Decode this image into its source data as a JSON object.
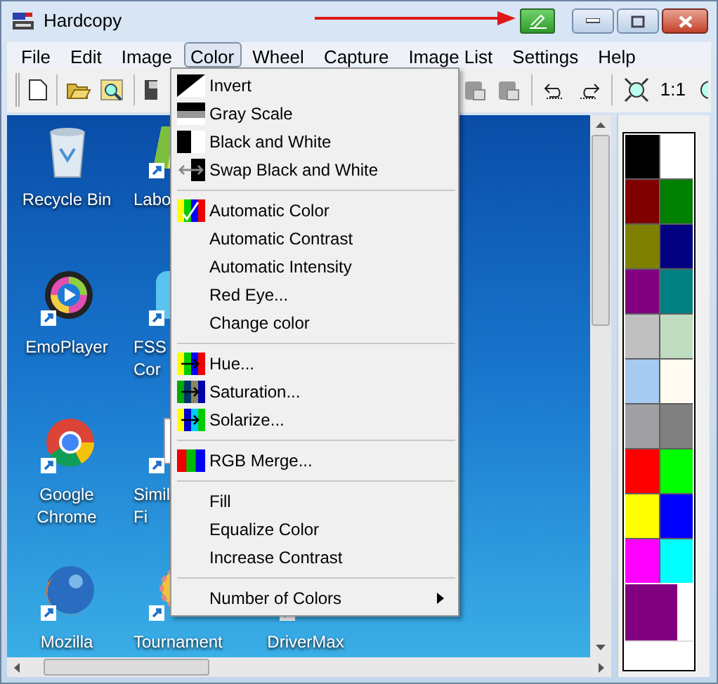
{
  "window": {
    "title": "Hardcopy"
  },
  "menubar": [
    {
      "label": "File",
      "selected": false
    },
    {
      "label": "Edit",
      "selected": false
    },
    {
      "label": "Image",
      "selected": false
    },
    {
      "label": "Color",
      "selected": true
    },
    {
      "label": "Wheel",
      "selected": false
    },
    {
      "label": "Capture",
      "selected": false
    },
    {
      "label": "Image List",
      "selected": false
    },
    {
      "label": "Settings",
      "selected": false
    },
    {
      "label": "Help",
      "selected": false
    }
  ],
  "toolbar": {
    "zoom_label": "1:1"
  },
  "desktop": {
    "rows": [
      [
        {
          "lines": [
            "Recycle Bin"
          ]
        },
        {
          "lines": [
            "Labo"
          ]
        }
      ],
      [
        {
          "lines": [
            "EmoPlayer"
          ]
        },
        {
          "lines": [
            "FSS",
            "Cor"
          ]
        }
      ],
      [
        {
          "lines": [
            "Google",
            "Chrome"
          ]
        },
        {
          "lines": [
            "Simil",
            "Fi"
          ]
        }
      ],
      [
        {
          "lines": [
            "Mozilla"
          ]
        },
        {
          "lines": [
            "Tournament"
          ]
        },
        {
          "lines": [
            "DriverMax"
          ]
        }
      ]
    ]
  },
  "color_menu": {
    "items": [
      {
        "kind": "item",
        "label": "Invert"
      },
      {
        "kind": "item",
        "label": "Gray Scale"
      },
      {
        "kind": "item",
        "label": "Black and White"
      },
      {
        "kind": "item",
        "label": "Swap Black and White"
      },
      {
        "kind": "separator"
      },
      {
        "kind": "item",
        "label": "Automatic Color"
      },
      {
        "kind": "item",
        "label": "Automatic Contrast"
      },
      {
        "kind": "item",
        "label": "Automatic Intensity"
      },
      {
        "kind": "item",
        "label": "Red Eye..."
      },
      {
        "kind": "item",
        "label": "Change color"
      },
      {
        "kind": "separator"
      },
      {
        "kind": "item",
        "label": "Hue..."
      },
      {
        "kind": "item",
        "label": "Saturation..."
      },
      {
        "kind": "item",
        "label": "Solarize..."
      },
      {
        "kind": "separator"
      },
      {
        "kind": "item",
        "label": "RGB Merge..."
      },
      {
        "kind": "separator"
      },
      {
        "kind": "item",
        "label": "Fill"
      },
      {
        "kind": "item",
        "label": "Equalize Color"
      },
      {
        "kind": "item",
        "label": "Increase Contrast"
      },
      {
        "kind": "separator"
      },
      {
        "kind": "submenu",
        "label": "Number of Colors"
      }
    ]
  },
  "palette": {
    "colors": [
      {
        "color": "#000000"
      },
      {
        "color": "#ffffff"
      },
      {
        "color": "#800000"
      },
      {
        "color": "#008000"
      },
      {
        "color": "#808000"
      },
      {
        "color": "#000080"
      },
      {
        "color": "#800080"
      },
      {
        "color": "#008080"
      },
      {
        "color": "#c0c0c0"
      },
      {
        "color": "#c0dcc0"
      },
      {
        "color": "#a6caf0"
      },
      {
        "color": "#fffbf0"
      },
      {
        "color": "#a0a0a4"
      },
      {
        "color": "#808080"
      },
      {
        "color": "#ff0000"
      },
      {
        "color": "#00ff00"
      },
      {
        "color": "#ffff00"
      },
      {
        "color": "#0000ff"
      },
      {
        "color": "#ff00ff"
      },
      {
        "color": "#00ffff"
      }
    ],
    "foreground": {
      "color": "#800080"
    },
    "background": {
      "color": "#ffffff"
    }
  }
}
